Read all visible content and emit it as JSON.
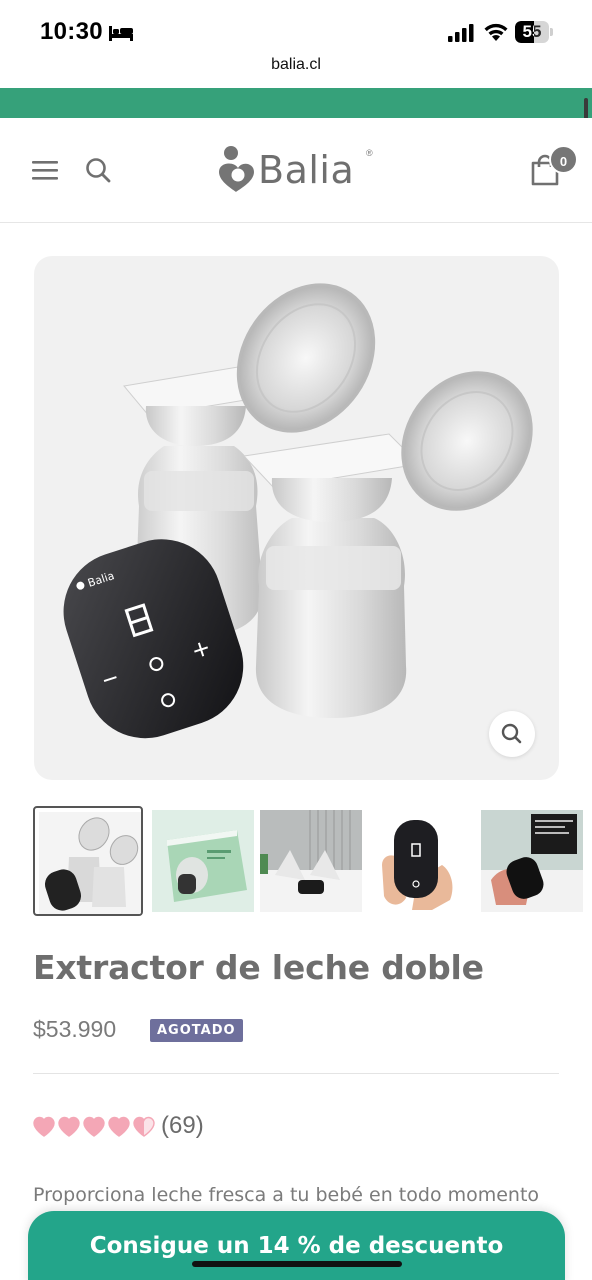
{
  "status_bar": {
    "time": "10:30",
    "battery_level": "55",
    "battery_fraction": 0.55
  },
  "browser": {
    "url": "balia.cl"
  },
  "header": {
    "logo_text": "Balia",
    "logo_registered": "®",
    "cart_count": "0"
  },
  "icons": {
    "menu": "menu-icon",
    "search": "search-icon",
    "cart": "cart-icon",
    "zoom": "zoom-icon",
    "rating": "heart-icon"
  },
  "product": {
    "image_brand_label": "Balia",
    "thumbnail_count": 5,
    "active_thumbnail": 0,
    "title": "Extractor de leche doble",
    "price": "$53.990",
    "badge": "AGOTADO",
    "rating_value": 4.5,
    "rating_max": 5,
    "rating_count": "(69)",
    "description": "Proporciona leche fresca a tu bebé en todo momento"
  },
  "cta": {
    "discount_label": "Consigue un 14 % de descuento"
  },
  "colors": {
    "brand_green": "#36a17a",
    "cta_green": "#23a58a",
    "badge_purple": "#6e6f9c",
    "heart_pink": "#f4a7b6"
  }
}
